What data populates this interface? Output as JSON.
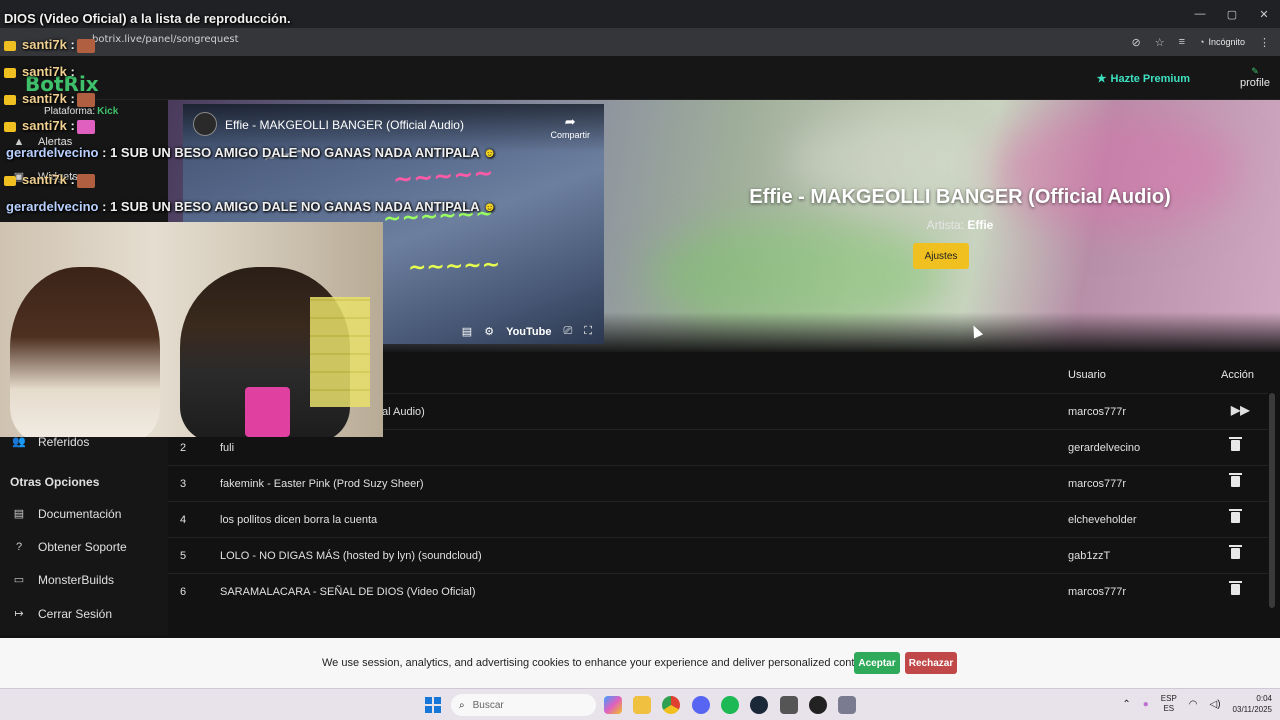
{
  "browser": {
    "url": "botrix.live/panel/songrequest",
    "incognito_label": "Incógnito"
  },
  "header": {
    "logo": "BotRix",
    "premium_label": "Hazte Premium",
    "profile_label": "profile"
  },
  "sidebar": {
    "platform_label": "Plataforma:",
    "platform_value": "Kick",
    "items": [
      {
        "label": "Alertas",
        "icon": "warning-icon"
      },
      {
        "label": "Widgets",
        "icon": "widgets-icon"
      },
      {
        "label": "Referidos",
        "icon": "users-icon"
      }
    ],
    "section_title": "Otras Opciones",
    "other_items": [
      {
        "label": "Documentación",
        "icon": "book-icon"
      },
      {
        "label": "Obtener Soporte",
        "icon": "help-icon"
      },
      {
        "label": "MonsterBuilds",
        "icon": "laptop-icon"
      },
      {
        "label": "Cerrar Sesión",
        "icon": "logout-icon"
      }
    ]
  },
  "player": {
    "video_title": "Effie - MAKGEOLLI BANGER (Official Audio)",
    "share_label": "Compartir",
    "youtube_label": "YouTube",
    "now_playing_title": "Effie - MAKGEOLLI BANGER (Official Audio)",
    "artist_label": "Artista:",
    "artist_name": "Effie",
    "settings_button": "Ajustes"
  },
  "queue": {
    "columns": {
      "user": "Usuario",
      "action": "Acción"
    },
    "rows": [
      {
        "num": "",
        "title": "al Audio)",
        "user": "marcos777r",
        "action": "skip"
      },
      {
        "num": "2",
        "title": "fuli",
        "user": "gerardelvecino",
        "action": "delete"
      },
      {
        "num": "3",
        "title": "fakemink - Easter Pink (Prod Suzy Sheer)",
        "user": "marcos777r",
        "action": "delete"
      },
      {
        "num": "4",
        "title": "los pollitos dicen borra la cuenta",
        "user": "elcheveholder",
        "action": "delete"
      },
      {
        "num": "5",
        "title": "LOLO - NO DIGAS MÁS (hosted by lyn) (soundcloud)",
        "user": "gab1zzT",
        "action": "delete"
      },
      {
        "num": "6",
        "title": "SARAMALACARA - SEÑAL DE DIOS (Video Oficial)",
        "user": "marcos777r",
        "action": "delete"
      }
    ]
  },
  "chat": {
    "top_line": "DIOS (Video Oficial) a la lista de reproducción.",
    "lines": [
      {
        "user": "santi7k",
        "text": ":"
      },
      {
        "user": "santi7k",
        "text": ":"
      },
      {
        "user": "santi7k",
        "text": ":"
      },
      {
        "user": "santi7k",
        "text": ":"
      },
      {
        "user": "gerardelvecino",
        "text": ": 1 SUB UN BESO AMIGO DALE NO GANAS NADA ANTIPALA"
      },
      {
        "user": "santi7k",
        "text": ":"
      },
      {
        "user": "gerardelvecino",
        "text": ": 1 SUB UN BESO AMIGO DALE NO GANAS NADA ANTIPALA"
      }
    ]
  },
  "cookie_banner": {
    "text": "We use session, analytics, and advertising cookies to enhance your experience and deliver personalized content.",
    "accept": "Aceptar",
    "reject": "Rechazar"
  },
  "taskbar": {
    "search_placeholder": "Buscar",
    "lang_top": "ESP",
    "lang_bottom": "ES",
    "time": "0:04",
    "date": "03/11/2025"
  },
  "colors": {
    "accent_green": "#3ec16a",
    "premium": "#3de0c0",
    "button_yellow": "#f0c020",
    "accept": "#2eaa5a",
    "reject": "#c04848"
  }
}
